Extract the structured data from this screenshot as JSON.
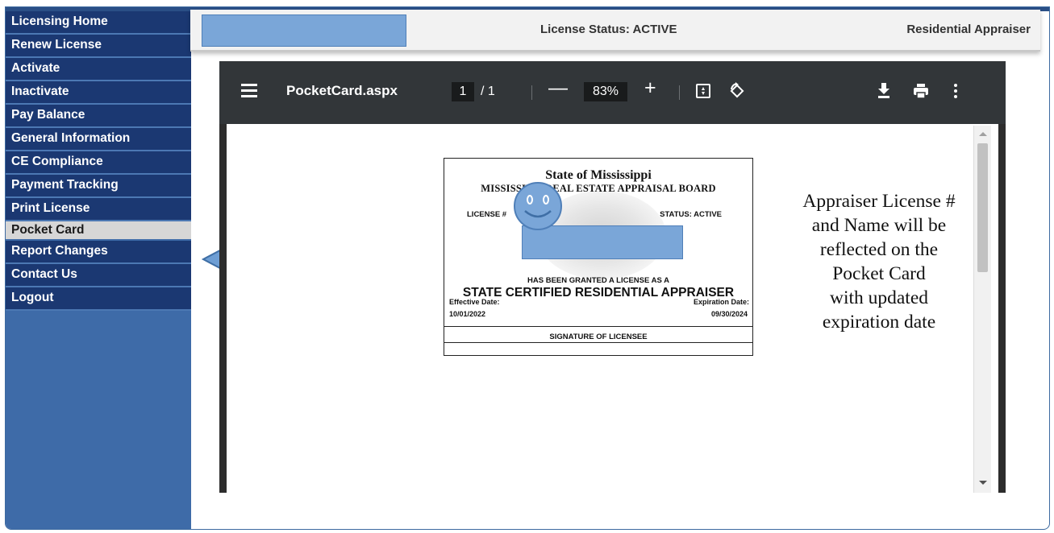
{
  "sidebar": {
    "items": [
      {
        "label": "Licensing Home"
      },
      {
        "label": "Renew License"
      },
      {
        "label": "Activate"
      },
      {
        "label": "Inactivate"
      },
      {
        "label": "Pay Balance"
      },
      {
        "label": "General Information"
      },
      {
        "label": "CE Compliance"
      },
      {
        "label": "Payment Tracking"
      },
      {
        "label": "Print License"
      },
      {
        "label": "Pocket Card"
      },
      {
        "label": "Report Changes"
      },
      {
        "label": "Contact Us"
      },
      {
        "label": "Logout"
      }
    ],
    "active_item": "Pocket Card"
  },
  "header": {
    "license_status": "License Status: ACTIVE",
    "license_type": "Residential Appraiser"
  },
  "pdf_viewer": {
    "document_name": "PocketCard.aspx",
    "current_page": "1",
    "page_total": "/ 1",
    "zoom_out": "—",
    "zoom": "83%",
    "zoom_in": "+",
    "icons": [
      "menu-icon",
      "fit-page-icon",
      "rotate-icon",
      "download-icon",
      "print-icon",
      "more-icon"
    ]
  },
  "pocket_card": {
    "state": "State of Mississippi",
    "board": "MISSISSIPPI REAL ESTATE APPRAISAL BOARD",
    "license_label": "LICENSE #",
    "status": "STATUS:  ACTIVE",
    "granted": "HAS BEEN GRANTED A LICENSE AS A",
    "license_type": "STATE CERTIFIED RESIDENTIAL APPRAISER",
    "effective_label": "Effective Date:",
    "effective_date": "10/01/2022",
    "expiration_label": "Expiration Date:",
    "expiration_date": "09/30/2024",
    "signature_label": "SIGNATURE OF LICENSEE"
  },
  "annotation": {
    "lines": [
      "Appraiser License #",
      "and Name will be",
      "reflected on the",
      "Pocket Card",
      "with updated",
      "expiration date"
    ]
  },
  "colors": {
    "sidebar_item": "#1b3872",
    "sidebar_bg": "#3e6ba8",
    "active_item": "#d6d6d6",
    "pdf_toolbar": "#323639",
    "redaction": "#7aa6d8",
    "arrow": "#6e9ed4"
  }
}
